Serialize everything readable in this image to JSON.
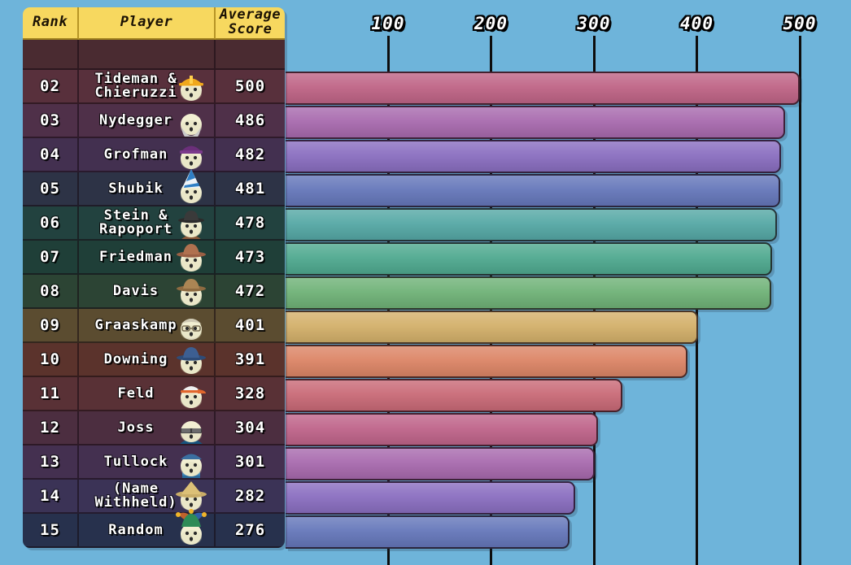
{
  "background_color": "#6eb4da",
  "table": {
    "headers": {
      "rank": "Rank",
      "player": "Player",
      "score": "Average\nScore"
    },
    "header_bg": "#f7d85f",
    "blank_row_bg": "#4a2b31",
    "rows": [
      {
        "rank": "02",
        "player": "Tideman &\nChieruzzi",
        "score": "500",
        "row_bg": "#58303c",
        "bar_color": "#bf6486",
        "avatar": "hardhat-yellow-avatar"
      },
      {
        "rank": "03",
        "player": "Nydegger",
        "score": "486",
        "row_bg": "#4f3049",
        "bar_color": "#a86aae",
        "avatar": "bald-beard-gray-avatar"
      },
      {
        "rank": "04",
        "player": "Grofman",
        "score": "482",
        "row_bg": "#433050",
        "bar_color": "#8a6ec0",
        "avatar": "purple-beanie-avatar"
      },
      {
        "rank": "05",
        "player": "Shubik",
        "score": "481",
        "row_bg": "#2d3346",
        "bar_color": "#6577ba",
        "avatar": "party-hat-blue-avatar"
      },
      {
        "rank": "06",
        "player": "Stein &\nRapoport",
        "score": "478",
        "row_bg": "#22423f",
        "bar_color": "#55a8a5",
        "avatar": "black-hat-avatar"
      },
      {
        "rank": "07",
        "player": "Friedman",
        "score": "473",
        "row_bg": "#1f3f38",
        "bar_color": "#4fa98f",
        "avatar": "brown-cowboy-hat-avatar"
      },
      {
        "rank": "08",
        "player": "Davis",
        "score": "472",
        "row_bg": "#2c4434",
        "bar_color": "#6fb277",
        "avatar": "tan-cowboy-hat-avatar"
      },
      {
        "rank": "09",
        "player": "Graaskamp",
        "score": "401",
        "row_bg": "#5b4c30",
        "bar_color": "#d3b06a",
        "avatar": "old-man-glasses-avatar"
      },
      {
        "rank": "10",
        "player": "Downing",
        "score": "391",
        "row_bg": "#5b332c",
        "bar_color": "#dc8566",
        "avatar": "blue-fedora-avatar"
      },
      {
        "rank": "11",
        "player": "Feld",
        "score": "328",
        "row_bg": "#593136",
        "bar_color": "#c96a77",
        "avatar": "orange-cap-avatar"
      },
      {
        "rank": "12",
        "player": "Joss",
        "score": "304",
        "row_bg": "#4c2e40",
        "bar_color": "#bf648a",
        "avatar": "sunglasses-blue-shirt-avatar"
      },
      {
        "rank": "13",
        "player": "Tullock",
        "score": "301",
        "row_bg": "#443050",
        "bar_color": "#a86aae",
        "avatar": "blue-turtleneck-avatar"
      },
      {
        "rank": "14",
        "player": "(Name\nWithheld)",
        "score": "282",
        "row_bg": "#3b3356",
        "bar_color": "#8a6ec0",
        "avatar": "straw-hat-avatar"
      },
      {
        "rank": "15",
        "player": "Random",
        "score": "276",
        "row_bg": "#27314d",
        "bar_color": "#6577ba",
        "avatar": "jester-hat-avatar"
      }
    ]
  },
  "chart_data": {
    "type": "bar",
    "orientation": "horizontal",
    "title": "",
    "xlabel": "",
    "ylabel": "",
    "xlim": [
      0,
      530
    ],
    "grid": true,
    "tick_labels": [
      "100",
      "200",
      "300",
      "400",
      "500"
    ],
    "ticks": [
      100,
      200,
      300,
      400,
      500
    ],
    "categories": [
      "Tideman & Chieruzzi",
      "Nydegger",
      "Grofman",
      "Shubik",
      "Stein & Rapoport",
      "Friedman",
      "Davis",
      "Graaskamp",
      "Downing",
      "Feld",
      "Joss",
      "Tullock",
      "(Name Withheld)",
      "Random"
    ],
    "values": [
      500,
      486,
      482,
      481,
      478,
      473,
      472,
      401,
      391,
      328,
      304,
      301,
      282,
      276
    ],
    "ranks": [
      "02",
      "03",
      "04",
      "05",
      "06",
      "07",
      "08",
      "09",
      "10",
      "11",
      "12",
      "13",
      "14",
      "15"
    ],
    "colors": [
      "#bf6486",
      "#a86aae",
      "#8a6ec0",
      "#6577ba",
      "#55a8a5",
      "#4fa98f",
      "#6fb277",
      "#d3b06a",
      "#dc8566",
      "#c96a77",
      "#bf648a",
      "#a86aae",
      "#8a6ec0",
      "#6577ba"
    ]
  }
}
